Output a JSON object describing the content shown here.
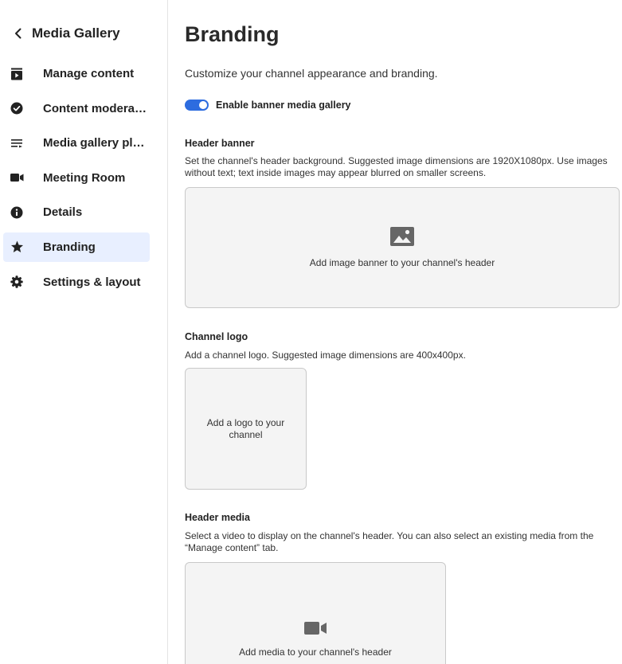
{
  "sidebar": {
    "back_title": "Media Gallery",
    "items": [
      {
        "label": "Manage content",
        "icon": "play-box-icon",
        "active": false
      },
      {
        "label": "Content moderation",
        "icon": "check-circle-icon",
        "active": false
      },
      {
        "label": "Media gallery playlists",
        "icon": "playlist-icon",
        "active": false
      },
      {
        "label": "Meeting Room",
        "icon": "video-camera-icon",
        "active": false
      },
      {
        "label": "Details",
        "icon": "info-icon",
        "active": false
      },
      {
        "label": "Branding",
        "icon": "star-icon",
        "active": true
      },
      {
        "label": "Settings & layout",
        "icon": "gear-icon",
        "active": false
      }
    ]
  },
  "main": {
    "title": "Branding",
    "subtitle": "Customize your channel appearance and branding.",
    "toggle": {
      "label": "Enable banner media gallery",
      "on": true
    },
    "header_banner": {
      "title": "Header banner",
      "description": "Set the channel's header background. Suggested image dimensions are 1920X1080px. Use images without text; text inside images may appear blurred on smaller screens.",
      "drop_label": "Add image banner to your channel's header"
    },
    "channel_logo": {
      "title": "Channel logo",
      "description": "Add a channel logo. Suggested image dimensions are 400x400px.",
      "drop_label": "Add a logo to your channel"
    },
    "header_media": {
      "title": "Header media",
      "description": "Select a video to display on the channel's header. You can also select an existing media from the “Manage content” tab.",
      "drop_label": "Add media to your channel's header"
    }
  },
  "colors": {
    "accent": "#2d6cdf",
    "active_bg": "#e8efff",
    "dropzone_bg": "#f4f4f4"
  }
}
